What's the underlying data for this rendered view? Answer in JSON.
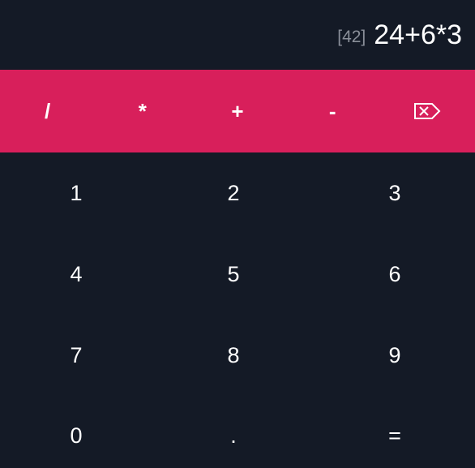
{
  "display": {
    "result": "[42]",
    "expression": "24+6*3"
  },
  "operators": [
    {
      "label": "/"
    },
    {
      "label": "*"
    },
    {
      "label": "+"
    },
    {
      "label": "-"
    },
    {
      "label": "",
      "icon": "backspace-icon"
    }
  ],
  "keypad": [
    {
      "label": "1"
    },
    {
      "label": "2"
    },
    {
      "label": "3"
    },
    {
      "label": "4"
    },
    {
      "label": "5"
    },
    {
      "label": "6"
    },
    {
      "label": "7"
    },
    {
      "label": "8"
    },
    {
      "label": "9"
    },
    {
      "label": "0"
    },
    {
      "label": "."
    },
    {
      "label": "="
    }
  ],
  "colors": {
    "background": "#141a26",
    "operator_bar": "#d81f5b",
    "result_text": "#8a8f99",
    "text": "#ffffff"
  }
}
